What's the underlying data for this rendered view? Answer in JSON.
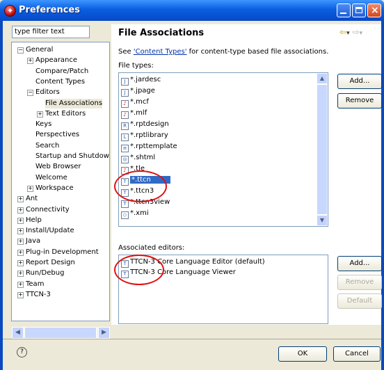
{
  "window": {
    "title": "Preferences"
  },
  "filter": {
    "placeholder": "type filter text"
  },
  "tree": [
    {
      "label": "General",
      "level": 0,
      "expander": "−"
    },
    {
      "label": "Appearance",
      "level": 1,
      "expander": "+"
    },
    {
      "label": "Compare/Patch",
      "level": 1,
      "expander": ""
    },
    {
      "label": "Content Types",
      "level": 1,
      "expander": ""
    },
    {
      "label": "Editors",
      "level": 1,
      "expander": "−"
    },
    {
      "label": "File Associations",
      "level": 2,
      "expander": "",
      "selected": true
    },
    {
      "label": "Text Editors",
      "level": 2,
      "expander": "+"
    },
    {
      "label": "Keys",
      "level": 1,
      "expander": ""
    },
    {
      "label": "Perspectives",
      "level": 1,
      "expander": ""
    },
    {
      "label": "Search",
      "level": 1,
      "expander": ""
    },
    {
      "label": "Startup and Shutdow",
      "level": 1,
      "expander": ""
    },
    {
      "label": "Web Browser",
      "level": 1,
      "expander": ""
    },
    {
      "label": "Welcome",
      "level": 1,
      "expander": ""
    },
    {
      "label": "Workspace",
      "level": 1,
      "expander": "+"
    },
    {
      "label": "Ant",
      "level": 0,
      "expander": "+"
    },
    {
      "label": "Connectivity",
      "level": 0,
      "expander": "+"
    },
    {
      "label": "Help",
      "level": 0,
      "expander": "+"
    },
    {
      "label": "Install/Update",
      "level": 0,
      "expander": "+"
    },
    {
      "label": "Java",
      "level": 0,
      "expander": "+"
    },
    {
      "label": "Plug-in Development",
      "level": 0,
      "expander": "+"
    },
    {
      "label": "Report Design",
      "level": 0,
      "expander": "+"
    },
    {
      "label": "Run/Debug",
      "level": 0,
      "expander": "+"
    },
    {
      "label": "Team",
      "level": 0,
      "expander": "+"
    },
    {
      "label": "TTCN-3",
      "level": 0,
      "expander": "+"
    }
  ],
  "page": {
    "title": "File Associations",
    "desc_prefix": "See ",
    "desc_link": "'Content Types'",
    "desc_suffix": " for content-type based file associations.",
    "file_types_label": "File types:",
    "associated_label": "Associated editors:"
  },
  "file_types": [
    {
      "name": "*.jardesc",
      "icon": "jar-file-icon"
    },
    {
      "name": "*.jpage",
      "icon": "scrapbook-icon"
    },
    {
      "name": "*.mcf",
      "icon": "mcf-file-icon"
    },
    {
      "name": "*.mlf",
      "icon": "mlf-file-icon"
    },
    {
      "name": "*.rptdesign",
      "icon": "report-design-icon"
    },
    {
      "name": "*.rptlibrary",
      "icon": "report-library-icon"
    },
    {
      "name": "*.rpttemplate",
      "icon": "report-template-icon"
    },
    {
      "name": "*.shtml",
      "icon": "web-file-icon"
    },
    {
      "name": "*.tle",
      "icon": "tle-file-icon"
    },
    {
      "name": "*.ttcn",
      "icon": "ttcn-file-icon",
      "selected": true
    },
    {
      "name": "*.ttcn3",
      "icon": "ttcn-file-icon"
    },
    {
      "name": "*.ttcn3view",
      "icon": "ttcn-file-icon"
    },
    {
      "name": "*.xmi",
      "icon": "xmi-file-icon"
    }
  ],
  "editors": [
    {
      "name": "TTCN-3 Core Language Editor (default)",
      "icon": "ttcn-file-icon"
    },
    {
      "name": "TTCN-3 Core Language Viewer",
      "icon": "ttcn-file-icon"
    }
  ],
  "buttons": {
    "add_type": "Add...",
    "remove_type": "Remove",
    "add_editor": "Add...",
    "remove_editor": "Remove",
    "default_editor": "Default",
    "ok": "OK",
    "cancel": "Cancel"
  },
  "icons": {
    "help": "?",
    "back": "⇦",
    "forward": "⇨",
    "dropdown": "▾"
  },
  "colors": {
    "title_bar": "#0a5fe0",
    "selection": "#316ac5",
    "annotation": "#e01010"
  }
}
